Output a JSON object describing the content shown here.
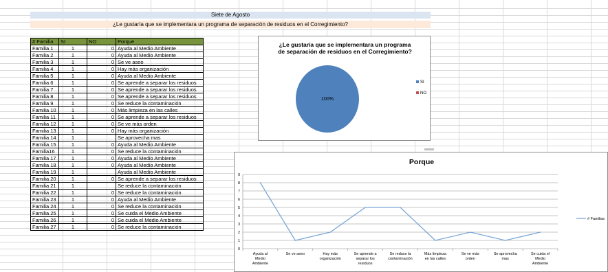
{
  "sheet": {
    "title": "Siete de Agosto",
    "question": "¿Le gustaría que se implementara un programa de separación de residuos en el Corregimiento?"
  },
  "table": {
    "headers": [
      "# Familia",
      "SI",
      "NO",
      "Porque"
    ],
    "rows": [
      [
        "Familia 1",
        "1",
        "0",
        "Ayuda al Medio Ambiente"
      ],
      [
        "Familia 2",
        "1",
        "0",
        "Ayuda al Medio Ambiente"
      ],
      [
        "Familia 3",
        "1",
        "0",
        "Se ve aseo"
      ],
      [
        "Familia 4",
        "1",
        "0",
        "Hay más organización"
      ],
      [
        "Familia 5",
        "1",
        "0",
        "Ayuda al Medio Ambiente"
      ],
      [
        "Familia 6",
        "1",
        "0",
        "Se aprende a separar los residuos"
      ],
      [
        "Familia 7",
        "1",
        "0",
        "Se aprende a separar los residuos"
      ],
      [
        "Familia 8",
        "1",
        "0",
        "Se aprende a separar los residuos"
      ],
      [
        "Familia 9",
        "1",
        "0",
        "Se reduce la contaminación"
      ],
      [
        "Familia 10",
        "1",
        "0",
        "Más limpieza en las calles"
      ],
      [
        "Familia 11",
        "1",
        "0",
        "Se aprende a separar los residuos"
      ],
      [
        "Familia 12",
        "1",
        "0",
        "Se ve más orden"
      ],
      [
        "Familia 13",
        "1",
        "0",
        "Hay más organización"
      ],
      [
        "Familia 14",
        "1",
        "",
        "Se aprovecha mas"
      ],
      [
        "Familia 15",
        "1",
        "0",
        "Ayuda al Medio Ambiente"
      ],
      [
        "Familia16",
        "1",
        "0",
        "Se reduce la contaminación"
      ],
      [
        "Familia 17",
        "1",
        "0",
        "Ayuda al Medio Ambiente"
      ],
      [
        "Familia 18",
        "1",
        "0",
        "Ayuda al Medio Ambiente"
      ],
      [
        "Familia 19",
        "1",
        "",
        "Ayuda al Medio Ambiente"
      ],
      [
        "Familia 20",
        "1",
        "0",
        "Se aprende a separar los residuos"
      ],
      [
        "Familia 21",
        "1",
        "",
        "Se reduce la contaminación"
      ],
      [
        "Familia 22",
        "1",
        "0",
        "Se reduce la contaminación"
      ],
      [
        "Familia 23",
        "1",
        "0",
        "Ayuda al Medio Ambiente"
      ],
      [
        "Familia 24",
        "1",
        "0",
        "Se reduce la contaminación"
      ],
      [
        "Familia 25",
        "1",
        "0",
        "Se cuida el Medio Ambiente"
      ],
      [
        "Familia 26",
        "1",
        "0",
        "Se cuida el Medio Ambiente"
      ],
      [
        "Familia 27",
        "1",
        "0",
        "Se reduce la contaminación"
      ]
    ]
  },
  "pie": {
    "title_line1": "¿Le gustaría que se implementara un programa",
    "title_line2": "de separación de residuos en el Corregimiento?",
    "slice_label": "100%",
    "legend": [
      {
        "label": "SI",
        "color": "#4f81bd"
      },
      {
        "label": "NO",
        "color": "#c0504d"
      }
    ]
  },
  "chart_data": {
    "type": "line",
    "title": "Porque",
    "categories": [
      "Ayuda al Medio Ambiente",
      "Se ve aseo",
      "Hay más organización",
      "Se aprende a separar los residuos",
      "Se reduce la contaminación",
      "Más limpieza en las calles",
      "Se ve más orden",
      "Se aprovecha mas",
      "Se cuida el Medio Ambiente"
    ],
    "series": [
      {
        "name": "# Familias",
        "values": [
          8,
          1,
          2,
          5,
          5,
          1,
          2,
          1,
          2
        ],
        "color": "#7ba7d7"
      }
    ],
    "ylim": [
      0,
      9
    ],
    "yticks": [
      0,
      1,
      2,
      3,
      4,
      5,
      6,
      7,
      8,
      9
    ],
    "grid": true,
    "legend_position": "right"
  }
}
